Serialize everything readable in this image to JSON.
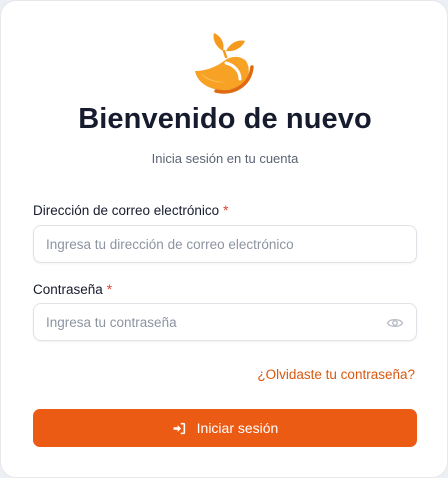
{
  "header": {
    "logo_icon": "orange-slice-leaves-icon",
    "title": "Bienvenido de nuevo",
    "subtitle": "Inicia sesión en tu cuenta"
  },
  "form": {
    "email": {
      "label": "Dirección de correo electrónico",
      "required_mark": "*",
      "value": "",
      "placeholder": "Ingresa tu dirección de correo electrónico"
    },
    "password": {
      "label": "Contraseña",
      "required_mark": "*",
      "value": "",
      "placeholder": "Ingresa tu contraseña",
      "toggle_icon": "eye-icon"
    },
    "forgot_link": "¿Olvidaste tu contraseña?",
    "submit": {
      "label": "Iniciar sesión",
      "icon": "sign-in-icon"
    }
  },
  "colors": {
    "accent": "#ec5b14",
    "link": "#d9570f",
    "required": "#e0402f",
    "logo": "#f59a1e"
  }
}
